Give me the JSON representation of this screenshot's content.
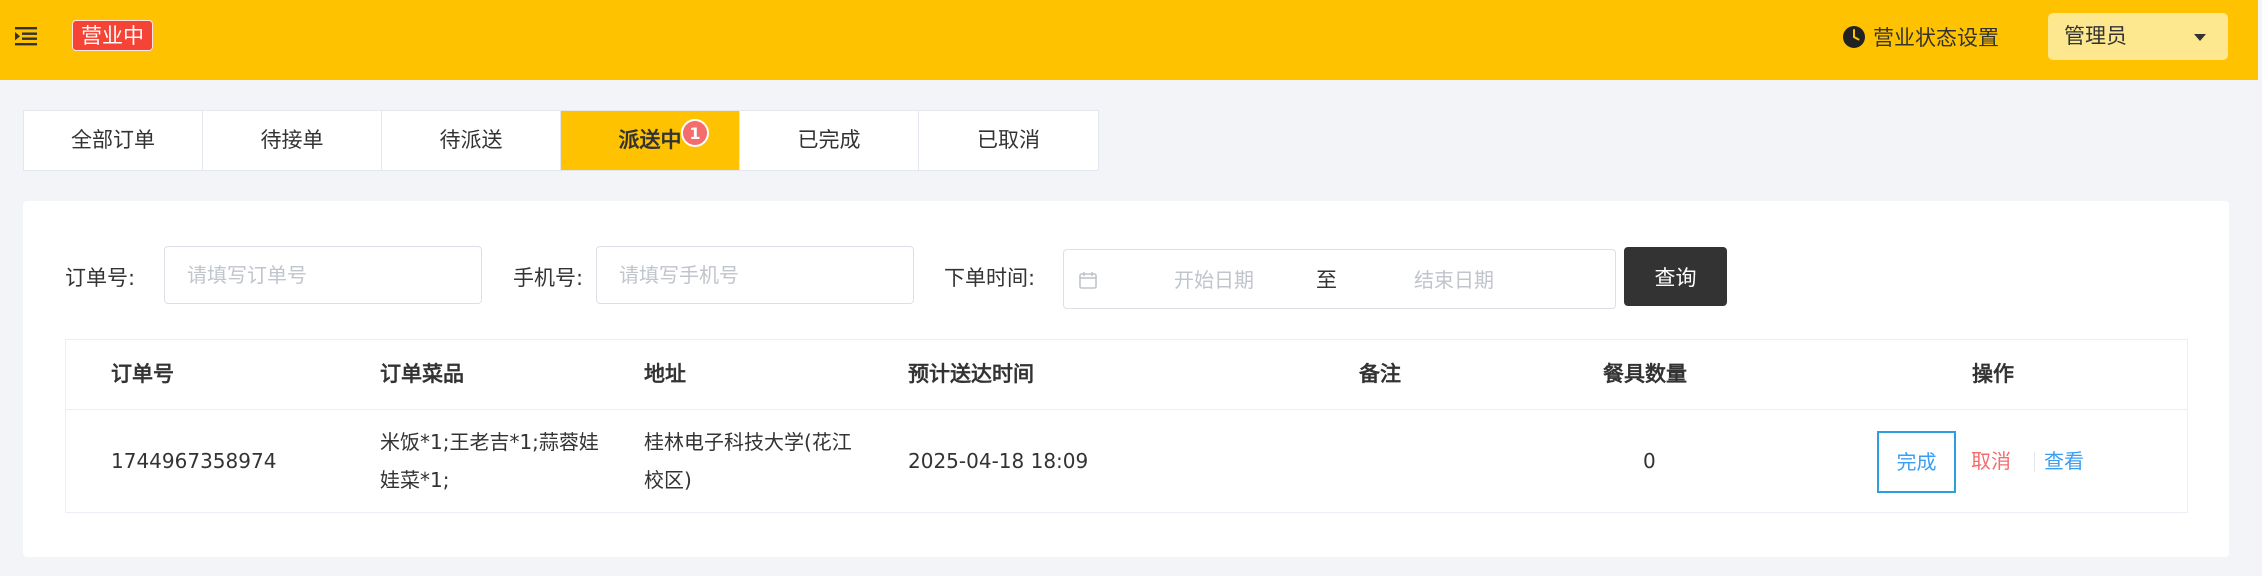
{
  "header": {
    "status_tag": "营业中",
    "status_setting_label": "营业状态设置",
    "admin_label": "管理员",
    "menu_icon": "menu-fold-icon",
    "clock_icon": "clock-icon",
    "bg_color": "#ffc200"
  },
  "tabs": [
    {
      "label": "全部订单",
      "active": false
    },
    {
      "label": "待接单",
      "active": false
    },
    {
      "label": "待派送",
      "active": false
    },
    {
      "label": "派送中",
      "active": true,
      "badge": "1"
    },
    {
      "label": "已完成",
      "active": false
    },
    {
      "label": "已取消",
      "active": false
    }
  ],
  "filters": {
    "order_no_label": "订单号:",
    "order_no_placeholder": "请填写订单号",
    "phone_label": "手机号:",
    "phone_placeholder": "请填写手机号",
    "time_label": "下单时间:",
    "start_placeholder": "开始日期",
    "range_separator": "至",
    "end_placeholder": "结束日期",
    "query_button": "查询"
  },
  "table": {
    "headers": [
      "订单号",
      "订单菜品",
      "地址",
      "预计送达时间",
      "备注",
      "餐具数量",
      "操作"
    ],
    "rows": [
      {
        "order_no": "1744967358974",
        "dishes_line1": "米饭*1;王老吉*1;蒜蓉娃",
        "dishes_line2": "娃菜*1;",
        "address_line1": "桂林电子科技大学(花江",
        "address_line2": "校区)",
        "eta": "2025-04-18 18:09",
        "remark": "",
        "tableware": "0",
        "actions": {
          "complete": "完成",
          "cancel": "取消",
          "view": "查看"
        }
      }
    ]
  }
}
